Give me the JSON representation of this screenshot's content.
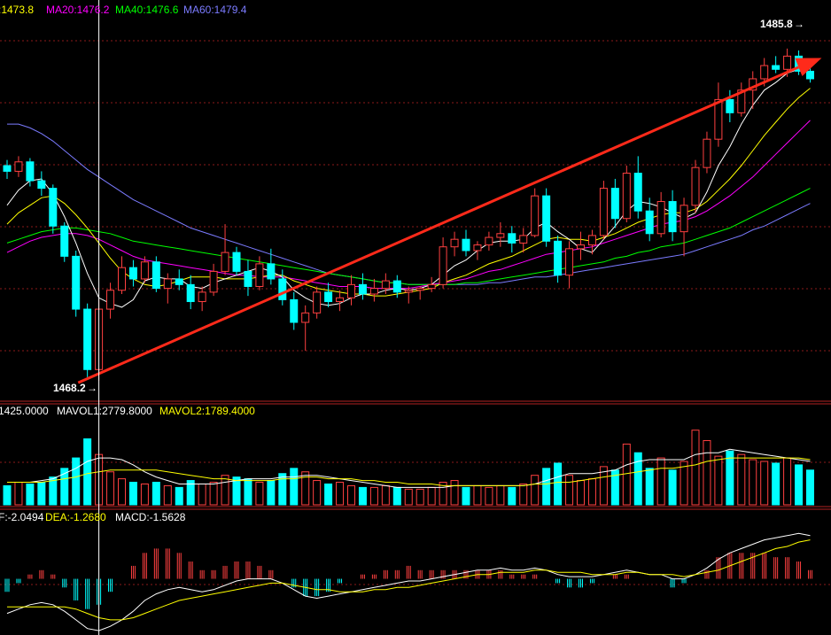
{
  "colors": {
    "background": "#000000",
    "grid": "#8b1a1a",
    "frame": "#b22222",
    "up": "#ff4040",
    "down": "#00ffff",
    "ma5": "#ffffff",
    "ma10": "#ffff00",
    "ma20": "#ff00ff",
    "ma40": "#00ff00",
    "ma60": "#7b7bff",
    "arrow": "#ff2a1a",
    "crosshair": "#ffffff"
  },
  "price_legend": {
    "ma10": ":1473.8",
    "ma20": "MA20:1476.2",
    "ma40": "MA40:1476.6",
    "ma60": "MA60:1479.4"
  },
  "volume_legend": {
    "vol": "1425.0000",
    "mavol1": "MAVOL1:2779.8000",
    "mavol2": "MAVOL2:1789.4000"
  },
  "macd_legend": {
    "dif": "F:-2.0494",
    "dea": "DEA:-1.2680",
    "macd": "MACD:-1.5628"
  },
  "annotations": {
    "high_label": "1485.8",
    "low_label": "1468.2"
  },
  "chart_data": {
    "type": "candlestick",
    "price_range": [
      1467.5,
      1487.2
    ],
    "high_value": 1485.8,
    "low_value": 1468.2,
    "trend_arrow": {
      "from": [
        0,
        1468.2
      ],
      "to": [
        71,
        1485.3
      ]
    },
    "crosshair_index": 8,
    "candles": [
      [
        1479.6,
        1479.9,
        1478.9,
        1479.3
      ],
      [
        1479.3,
        1480.1,
        1479.0,
        1479.8
      ],
      [
        1479.8,
        1480.0,
        1478.5,
        1478.8
      ],
      [
        1478.8,
        1479.3,
        1478.0,
        1478.4
      ],
      [
        1478.4,
        1478.6,
        1476.0,
        1476.4
      ],
      [
        1476.4,
        1476.6,
        1474.5,
        1474.8
      ],
      [
        1474.8,
        1475.1,
        1471.6,
        1472.0
      ],
      [
        1472.0,
        1472.3,
        1468.4,
        1468.8
      ],
      [
        1468.8,
        1472.5,
        1468.2,
        1472.0
      ],
      [
        1472.0,
        1473.4,
        1471.5,
        1473.0
      ],
      [
        1473.0,
        1474.8,
        1472.8,
        1474.2
      ],
      [
        1474.2,
        1474.6,
        1473.2,
        1473.6
      ],
      [
        1473.6,
        1474.8,
        1473.4,
        1474.5
      ],
      [
        1474.5,
        1474.8,
        1472.9,
        1473.1
      ],
      [
        1473.1,
        1473.9,
        1472.3,
        1473.6
      ],
      [
        1473.6,
        1474.1,
        1473.0,
        1473.3
      ],
      [
        1473.3,
        1473.8,
        1472.0,
        1472.4
      ],
      [
        1472.4,
        1473.2,
        1471.9,
        1472.9
      ],
      [
        1472.9,
        1474.4,
        1472.7,
        1474.0
      ],
      [
        1474.0,
        1476.5,
        1473.8,
        1475.0
      ],
      [
        1475.0,
        1475.3,
        1473.8,
        1474.0
      ],
      [
        1474.0,
        1474.6,
        1472.7,
        1473.2
      ],
      [
        1473.2,
        1474.8,
        1473.0,
        1474.4
      ],
      [
        1474.4,
        1475.2,
        1473.3,
        1473.6
      ],
      [
        1473.6,
        1474.1,
        1472.2,
        1472.5
      ],
      [
        1472.5,
        1472.9,
        1470.9,
        1471.3
      ],
      [
        1471.3,
        1472.2,
        1469.8,
        1471.8
      ],
      [
        1471.8,
        1473.2,
        1471.5,
        1472.9
      ],
      [
        1472.9,
        1473.4,
        1472.1,
        1472.4
      ],
      [
        1472.4,
        1473.0,
        1471.9,
        1472.6
      ],
      [
        1472.6,
        1473.8,
        1472.2,
        1473.3
      ],
      [
        1473.3,
        1473.9,
        1472.5,
        1472.8
      ],
      [
        1472.8,
        1473.6,
        1472.4,
        1473.1
      ],
      [
        1473.1,
        1473.9,
        1472.8,
        1473.5
      ],
      [
        1473.5,
        1473.8,
        1472.6,
        1472.9
      ],
      [
        1472.9,
        1473.2,
        1472.3,
        1473.0
      ],
      [
        1473.0,
        1473.2,
        1472.5,
        1473.1
      ],
      [
        1473.1,
        1473.7,
        1472.9,
        1473.3
      ],
      [
        1473.3,
        1475.8,
        1473.1,
        1475.3
      ],
      [
        1475.3,
        1476.1,
        1474.8,
        1475.7
      ],
      [
        1475.7,
        1476.2,
        1474.8,
        1475.1
      ],
      [
        1475.1,
        1475.6,
        1474.6,
        1475.4
      ],
      [
        1475.4,
        1476.1,
        1475.1,
        1475.8
      ],
      [
        1475.8,
        1476.6,
        1475.3,
        1476.0
      ],
      [
        1476.0,
        1476.4,
        1475.0,
        1475.5
      ],
      [
        1475.5,
        1476.3,
        1475.0,
        1475.9
      ],
      [
        1475.9,
        1478.4,
        1475.8,
        1478.0
      ],
      [
        1478.0,
        1478.4,
        1475.3,
        1475.6
      ],
      [
        1475.6,
        1475.9,
        1473.4,
        1473.8
      ],
      [
        1473.8,
        1475.6,
        1473.1,
        1475.2
      ],
      [
        1475.2,
        1476.1,
        1474.6,
        1475.4
      ],
      [
        1475.4,
        1476.2,
        1474.9,
        1475.9
      ],
      [
        1475.9,
        1478.8,
        1475.7,
        1478.4
      ],
      [
        1478.4,
        1478.9,
        1476.3,
        1476.8
      ],
      [
        1476.8,
        1479.6,
        1476.6,
        1479.2
      ],
      [
        1479.2,
        1480.1,
        1476.8,
        1477.2
      ],
      [
        1477.2,
        1477.9,
        1475.6,
        1476.0
      ],
      [
        1476.0,
        1478.2,
        1475.8,
        1477.7
      ],
      [
        1477.7,
        1478.3,
        1475.6,
        1476.1
      ],
      [
        1476.1,
        1477.9,
        1474.8,
        1477.5
      ],
      [
        1477.5,
        1479.9,
        1477.1,
        1479.5
      ],
      [
        1479.5,
        1481.4,
        1479.2,
        1481.0
      ],
      [
        1481.0,
        1484.0,
        1480.6,
        1483.1
      ],
      [
        1483.1,
        1483.6,
        1481.9,
        1482.4
      ],
      [
        1482.4,
        1484.0,
        1482.2,
        1483.6
      ],
      [
        1483.6,
        1484.6,
        1482.6,
        1484.2
      ],
      [
        1484.2,
        1485.3,
        1483.8,
        1484.9
      ],
      [
        1484.9,
        1485.4,
        1484.5,
        1484.7
      ],
      [
        1484.7,
        1485.8,
        1484.3,
        1485.4
      ],
      [
        1485.4,
        1485.7,
        1484.4,
        1484.6
      ],
      [
        1484.6,
        1485.0,
        1484.0,
        1484.2
      ]
    ],
    "ma5": [
      1477.5,
      1478.3,
      1478.8,
      1478.9,
      1478.1,
      1476.9,
      1475.5,
      1473.9,
      1472.6,
      1472.3,
      1472.1,
      1472.5,
      1473.5,
      1473.7,
      1473.6,
      1473.6,
      1473.2,
      1473.1,
      1473.4,
      1473.6,
      1473.8,
      1474.0,
      1474.2,
      1474.0,
      1473.7,
      1473.0,
      1472.6,
      1472.3,
      1472.2,
      1472.3,
      1472.6,
      1472.8,
      1472.8,
      1473.0,
      1473.1,
      1473.0,
      1473.1,
      1473.3,
      1473.8,
      1474.3,
      1474.6,
      1475.1,
      1475.5,
      1475.6,
      1475.6,
      1475.7,
      1476.3,
      1476.6,
      1476.1,
      1475.7,
      1475.2,
      1475.0,
      1475.7,
      1476.4,
      1477.2,
      1477.7,
      1477.6,
      1477.4,
      1477.1,
      1476.8,
      1477.1,
      1478.2,
      1479.6,
      1480.6,
      1481.8,
      1482.8,
      1483.6,
      1484.0,
      1484.5,
      1484.7,
      1484.8
    ],
    "ma10": [
      1476.5,
      1477.1,
      1477.5,
      1477.9,
      1478.0,
      1477.6,
      1477.0,
      1476.3,
      1475.5,
      1474.7,
      1474.0,
      1473.6,
      1473.3,
      1473.2,
      1473.3,
      1473.5,
      1473.7,
      1473.7,
      1473.7,
      1473.6,
      1473.6,
      1473.6,
      1473.7,
      1473.8,
      1473.8,
      1473.5,
      1473.3,
      1473.1,
      1473.0,
      1472.9,
      1472.8,
      1472.8,
      1472.7,
      1472.7,
      1472.8,
      1472.9,
      1473.0,
      1473.1,
      1473.4,
      1473.6,
      1473.8,
      1474.1,
      1474.4,
      1474.6,
      1474.8,
      1475.1,
      1475.4,
      1475.7,
      1475.8,
      1475.7,
      1475.7,
      1475.6,
      1475.8,
      1476.0,
      1476.3,
      1476.6,
      1476.8,
      1477.0,
      1477.1,
      1477.1,
      1477.3,
      1477.7,
      1478.3,
      1478.9,
      1479.6,
      1480.4,
      1481.2,
      1481.9,
      1482.6,
      1483.2,
      1483.7
    ],
    "ma20": [
      1475.0,
      1475.3,
      1475.6,
      1475.8,
      1475.9,
      1476.0,
      1476.0,
      1475.9,
      1475.7,
      1475.4,
      1475.1,
      1474.8,
      1474.6,
      1474.5,
      1474.4,
      1474.3,
      1474.2,
      1474.1,
      1474.0,
      1473.9,
      1473.8,
      1473.8,
      1473.7,
      1473.7,
      1473.7,
      1473.6,
      1473.5,
      1473.4,
      1473.3,
      1473.2,
      1473.2,
      1473.2,
      1473.1,
      1473.1,
      1473.1,
      1473.1,
      1473.2,
      1473.3,
      1473.4,
      1473.5,
      1473.6,
      1473.8,
      1474.0,
      1474.1,
      1474.3,
      1474.5,
      1474.7,
      1474.9,
      1475.0,
      1475.1,
      1475.2,
      1475.3,
      1475.5,
      1475.7,
      1475.9,
      1476.1,
      1476.3,
      1476.5,
      1476.6,
      1476.7,
      1476.9,
      1477.2,
      1477.6,
      1478.0,
      1478.5,
      1479.0,
      1479.6,
      1480.2,
      1480.8,
      1481.4,
      1482.0
    ],
    "ma40": [
      1475.5,
      1475.7,
      1475.9,
      1476.1,
      1476.2,
      1476.3,
      1476.3,
      1476.2,
      1476.1,
      1476.0,
      1475.8,
      1475.6,
      1475.5,
      1475.4,
      1475.3,
      1475.2,
      1475.1,
      1475.0,
      1474.9,
      1474.8,
      1474.7,
      1474.6,
      1474.5,
      1474.4,
      1474.3,
      1474.2,
      1474.1,
      1474.0,
      1473.9,
      1473.8,
      1473.7,
      1473.6,
      1473.5,
      1473.4,
      1473.4,
      1473.3,
      1473.3,
      1473.3,
      1473.3,
      1473.3,
      1473.4,
      1473.4,
      1473.5,
      1473.6,
      1473.7,
      1473.8,
      1473.9,
      1474.0,
      1474.1,
      1474.2,
      1474.3,
      1474.4,
      1474.5,
      1474.7,
      1474.8,
      1475.0,
      1475.1,
      1475.3,
      1475.4,
      1475.5,
      1475.7,
      1475.9,
      1476.1,
      1476.3,
      1476.6,
      1476.9,
      1477.2,
      1477.5,
      1477.8,
      1478.1,
      1478.4
    ],
    "ma60": [
      1481.8,
      1481.8,
      1481.6,
      1481.3,
      1480.9,
      1480.4,
      1479.9,
      1479.4,
      1479.0,
      1478.6,
      1478.2,
      1477.8,
      1477.5,
      1477.2,
      1476.9,
      1476.6,
      1476.3,
      1476.1,
      1475.9,
      1475.7,
      1475.5,
      1475.3,
      1475.1,
      1474.9,
      1474.7,
      1474.5,
      1474.3,
      1474.1,
      1473.9,
      1473.8,
      1473.7,
      1473.6,
      1473.5,
      1473.4,
      1473.4,
      1473.3,
      1473.3,
      1473.3,
      1473.3,
      1473.3,
      1473.3,
      1473.3,
      1473.4,
      1473.4,
      1473.5,
      1473.6,
      1473.7,
      1473.7,
      1473.8,
      1473.9,
      1474.0,
      1474.1,
      1474.2,
      1474.3,
      1474.4,
      1474.5,
      1474.6,
      1474.7,
      1474.8,
      1474.9,
      1475.1,
      1475.3,
      1475.5,
      1475.7,
      1475.9,
      1476.2,
      1476.4,
      1476.7,
      1477.0,
      1477.3,
      1477.6
    ],
    "volume": [
      1100,
      1300,
      1200,
      1300,
      1600,
      2100,
      2700,
      3800,
      2900,
      1900,
      1500,
      1300,
      1200,
      1300,
      1100,
      1000,
      1400,
      1200,
      1300,
      1700,
      1600,
      1500,
      1300,
      1400,
      1800,
      2100,
      1900,
      1400,
      1200,
      1300,
      1100,
      1000,
      1000,
      1100,
      1000,
      900,
      900,
      1000,
      1300,
      1400,
      1000,
      1100,
      1000,
      1100,
      1000,
      1200,
      1700,
      2100,
      2400,
      1700,
      1400,
      1500,
      2200,
      2000,
      3500,
      3000,
      2100,
      2700,
      2000,
      2500,
      4300,
      3700,
      2800,
      3100,
      2900,
      2600,
      2500,
      2400,
      2700,
      2300,
      2000
    ],
    "volume_range": [
      0,
      5000
    ],
    "mavol1": [
      1300,
      1300,
      1300,
      1400,
      1500,
      1800,
      2100,
      2500,
      2700,
      2700,
      2600,
      2300,
      1900,
      1600,
      1400,
      1200,
      1200,
      1200,
      1200,
      1300,
      1400,
      1500,
      1500,
      1500,
      1600,
      1600,
      1700,
      1700,
      1600,
      1500,
      1400,
      1300,
      1200,
      1100,
      1000,
      1000,
      1000,
      1000,
      1000,
      1100,
      1100,
      1100,
      1100,
      1100,
      1100,
      1100,
      1200,
      1400,
      1600,
      1800,
      1800,
      1800,
      1900,
      2000,
      2300,
      2500,
      2600,
      2600,
      2600,
      2600,
      2900,
      3000,
      3000,
      3200,
      3100,
      3000,
      2900,
      2800,
      2700,
      2600,
      2500
    ],
    "mavol2": [
      1300,
      1300,
      1300,
      1300,
      1400,
      1500,
      1600,
      1800,
      1900,
      2000,
      2000,
      2000,
      2000,
      2000,
      1900,
      1800,
      1700,
      1600,
      1500,
      1500,
      1400,
      1400,
      1400,
      1400,
      1500,
      1500,
      1600,
      1600,
      1500,
      1500,
      1500,
      1400,
      1400,
      1300,
      1300,
      1200,
      1200,
      1200,
      1100,
      1100,
      1100,
      1100,
      1100,
      1100,
      1100,
      1100,
      1200,
      1200,
      1300,
      1300,
      1400,
      1500,
      1600,
      1700,
      1800,
      1900,
      2000,
      2100,
      2100,
      2200,
      2300,
      2500,
      2600,
      2700,
      2700,
      2700,
      2700,
      2700,
      2700,
      2700,
      2600
    ],
    "macd_range": [
      -2.6,
      2.4
    ],
    "dif": [
      -1.6,
      -1.4,
      -1.2,
      -1.1,
      -1.2,
      -1.5,
      -1.9,
      -2.3,
      -2.4,
      -2.2,
      -1.9,
      -1.5,
      -1.0,
      -0.7,
      -0.5,
      -0.4,
      -0.5,
      -0.6,
      -0.5,
      -0.3,
      -0.1,
      0.0,
      0.0,
      0.0,
      -0.2,
      -0.5,
      -0.8,
      -0.9,
      -0.8,
      -0.7,
      -0.6,
      -0.5,
      -0.4,
      -0.3,
      -0.2,
      -0.1,
      -0.1,
      0.0,
      0.1,
      0.2,
      0.3,
      0.4,
      0.4,
      0.5,
      0.4,
      0.4,
      0.5,
      0.4,
      0.2,
      0.1,
      0.1,
      0.1,
      0.2,
      0.3,
      0.4,
      0.3,
      0.2,
      0.2,
      0.0,
      0.0,
      0.2,
      0.5,
      0.9,
      1.2,
      1.4,
      1.6,
      1.8,
      1.9,
      2.0,
      2.1,
      2.0
    ],
    "dea": [
      -1.3,
      -1.3,
      -1.3,
      -1.3,
      -1.3,
      -1.3,
      -1.4,
      -1.6,
      -1.8,
      -1.9,
      -1.9,
      -1.8,
      -1.6,
      -1.4,
      -1.2,
      -1.0,
      -0.9,
      -0.8,
      -0.7,
      -0.6,
      -0.5,
      -0.4,
      -0.3,
      -0.2,
      -0.2,
      -0.3,
      -0.4,
      -0.5,
      -0.5,
      -0.6,
      -0.6,
      -0.6,
      -0.5,
      -0.5,
      -0.4,
      -0.4,
      -0.3,
      -0.2,
      -0.1,
      0.0,
      0.1,
      0.2,
      0.2,
      0.3,
      0.3,
      0.3,
      0.4,
      0.4,
      0.3,
      0.3,
      0.3,
      0.2,
      0.2,
      0.2,
      0.3,
      0.3,
      0.2,
      0.2,
      0.2,
      0.1,
      0.2,
      0.3,
      0.4,
      0.6,
      0.8,
      1.0,
      1.2,
      1.4,
      1.5,
      1.7,
      1.8
    ],
    "macd": [
      -0.6,
      -0.2,
      0.2,
      0.4,
      0.2,
      -0.4,
      -1.0,
      -1.4,
      -1.2,
      -0.6,
      0.0,
      0.6,
      1.2,
      1.4,
      1.4,
      1.2,
      0.8,
      0.4,
      0.4,
      0.6,
      0.8,
      0.8,
      0.6,
      0.4,
      0.0,
      -0.4,
      -0.8,
      -0.8,
      -0.6,
      -0.2,
      0.0,
      0.2,
      0.2,
      0.4,
      0.4,
      0.6,
      0.4,
      0.4,
      0.4,
      0.4,
      0.4,
      0.4,
      0.4,
      0.4,
      0.2,
      0.2,
      0.2,
      0.0,
      -0.2,
      -0.4,
      -0.4,
      -0.2,
      0.0,
      0.2,
      0.2,
      0.0,
      0.0,
      0.0,
      -0.4,
      -0.2,
      0.0,
      0.4,
      1.0,
      1.2,
      1.2,
      1.2,
      1.2,
      1.0,
      1.0,
      0.8,
      0.4
    ]
  }
}
